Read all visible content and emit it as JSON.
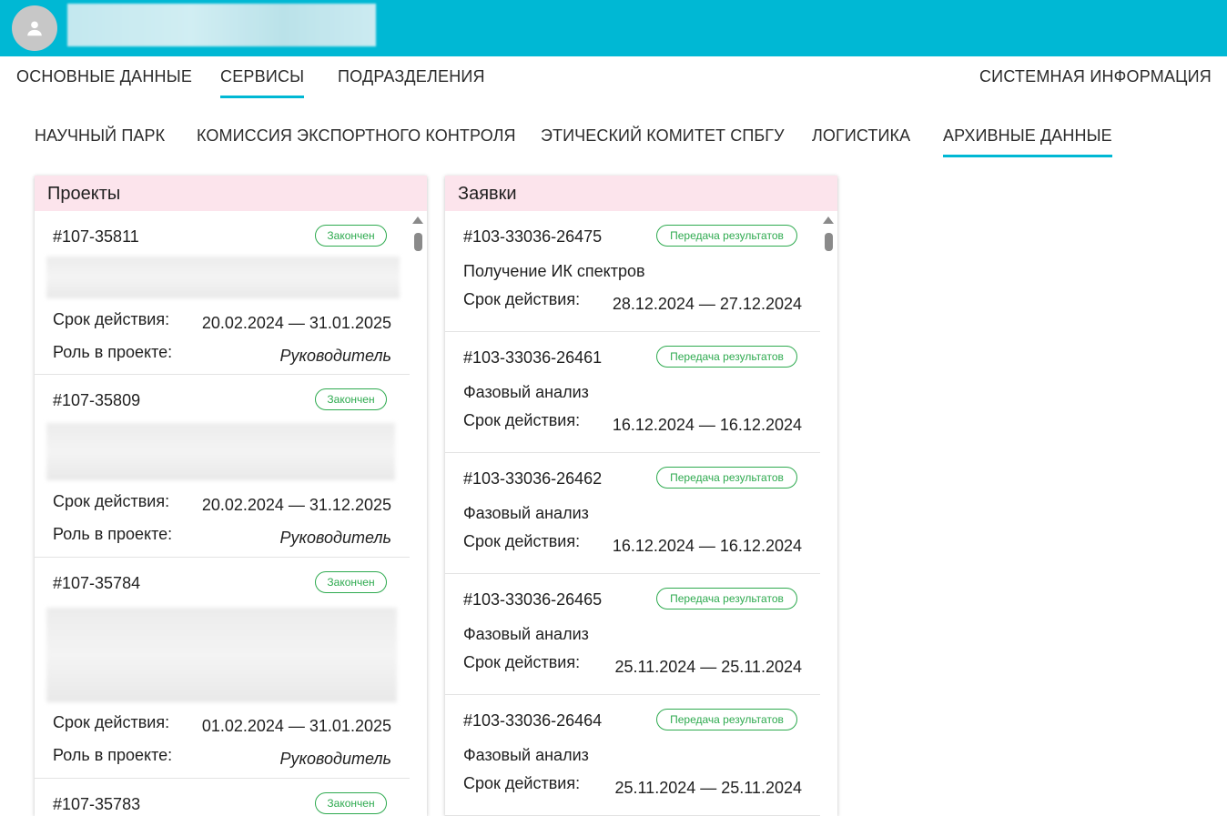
{
  "header": {
    "avatar_icon": "person-icon"
  },
  "main_tabs": [
    {
      "label": "ОСНОВНЫЕ ДАННЫЕ"
    },
    {
      "label": "СЕРВИСЫ"
    },
    {
      "label": "ПОДРАЗДЕЛЕНИЯ"
    },
    {
      "label": "СИСТЕМНАЯ ИНФОРМАЦИЯ"
    }
  ],
  "main_tabs_active": "СЕРВИСЫ",
  "sub_tabs": [
    {
      "label": "НАУЧНЫЙ ПАРК"
    },
    {
      "label": "КОМИССИЯ ЭКСПОРТНОГО КОНТРОЛЯ"
    },
    {
      "label": "ЭТИЧЕСКИЙ КОМИТЕТ СПБГУ"
    },
    {
      "label": "ЛОГИСТИКА"
    },
    {
      "label": "АРХИВНЫЕ ДАННЫЕ"
    }
  ],
  "sub_tabs_active": "АРХИВНЫЕ ДАННЫЕ",
  "projects": {
    "title": "Проекты",
    "term_label": "Срок действия:",
    "role_label": "Роль в проекте:",
    "items": [
      {
        "id": "#107-35811",
        "status": "Закончен",
        "term": "20.02.2024 — 31.01.2025",
        "role": "Руководитель"
      },
      {
        "id": "#107-35809",
        "status": "Закончен",
        "term": "20.02.2024 — 31.12.2025",
        "role": "Руководитель"
      },
      {
        "id": "#107-35784",
        "status": "Закончен",
        "term": "01.02.2024 — 31.01.2025",
        "role": "Руководитель"
      },
      {
        "id": "#107-35783",
        "status": "Закончен"
      }
    ]
  },
  "requests": {
    "title": "Заявки",
    "term_label": "Срок действия:",
    "items": [
      {
        "id": "#103-33036-26475",
        "status": "Передача результатов",
        "description": "Получение ИК спектров",
        "term": "28.12.2024 — 27.12.2024"
      },
      {
        "id": "#103-33036-26461",
        "status": "Передача результатов",
        "description": "Фазовый анализ",
        "term": "16.12.2024 — 16.12.2024"
      },
      {
        "id": "#103-33036-26462",
        "status": "Передача результатов",
        "description": "Фазовый анализ",
        "term": "16.12.2024 — 16.12.2024"
      },
      {
        "id": "#103-33036-26465",
        "status": "Передача результатов",
        "description": "Фазовый анализ",
        "term": "25.11.2024 — 25.11.2024"
      },
      {
        "id": "#103-33036-26464",
        "status": "Передача результатов",
        "description": "Фазовый анализ",
        "term": "25.11.2024 — 25.11.2024"
      }
    ]
  }
}
